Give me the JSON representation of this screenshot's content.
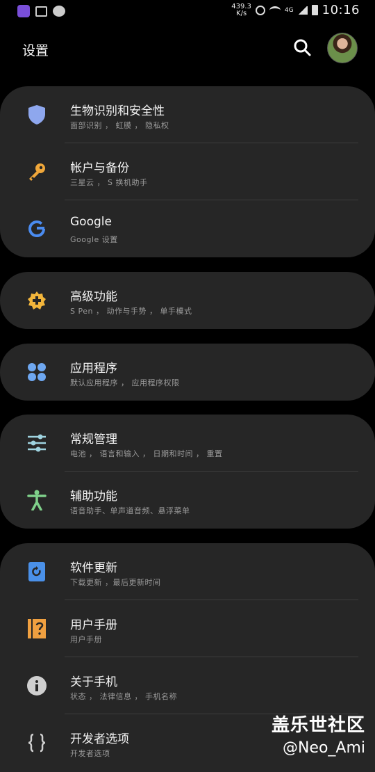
{
  "status_bar": {
    "speed_value": "439.3",
    "speed_unit": "K/s",
    "network": "4G",
    "time": "10:16"
  },
  "header": {
    "title": "设置"
  },
  "colors": {
    "card_bg": "#262626",
    "shield": "#8ea7ee",
    "key": "#f0a73a",
    "plus_gear": "#f2b53b",
    "apps": "#6ea7f0",
    "sliders": "#9fd3e0",
    "accessibility": "#7fd08a",
    "update": "#4a90e8",
    "manual": "#f0a040",
    "info": "#cfcfcf"
  },
  "groups": [
    {
      "items": [
        {
          "label": "生物识别和安全性",
          "sub": "面部识别 ， 虹膜 ， 隐私权",
          "icon": "shield-icon"
        },
        {
          "label": "帐户与备份",
          "sub": "三星云 ， S 换机助手",
          "icon": "key-icon"
        },
        {
          "label": "Google",
          "sub": "Google 设置",
          "icon": "google-icon"
        }
      ]
    },
    {
      "items": [
        {
          "label": "高级功能",
          "sub": "S Pen ， 动作与手势 ， 单手模式",
          "icon": "gear-plus-icon"
        }
      ]
    },
    {
      "items": [
        {
          "label": "应用程序",
          "sub": "默认应用程序 ， 应用程序权限",
          "icon": "apps-grid-icon"
        }
      ]
    },
    {
      "items": [
        {
          "label": "常规管理",
          "sub": "电池 ， 语言和输入 ， 日期和时间 ， 重置",
          "icon": "sliders-icon"
        },
        {
          "label": "辅助功能",
          "sub": "语音助手、单声道音频、悬浮菜单",
          "icon": "accessibility-icon"
        }
      ]
    },
    {
      "items": [
        {
          "label": "软件更新",
          "sub": "下载更新 ，最后更新时间",
          "icon": "update-icon"
        },
        {
          "label": "用户手册",
          "sub": "用户手册",
          "icon": "manual-icon"
        },
        {
          "label": "关于手机",
          "sub": "状态 ， 法律信息 ， 手机名称",
          "icon": "info-icon"
        },
        {
          "label": "开发者选项",
          "sub": "开发者选项",
          "icon": "braces-icon"
        }
      ]
    }
  ],
  "watermark": {
    "brand": "盖乐世社区",
    "user": "@Neo_Ami"
  }
}
